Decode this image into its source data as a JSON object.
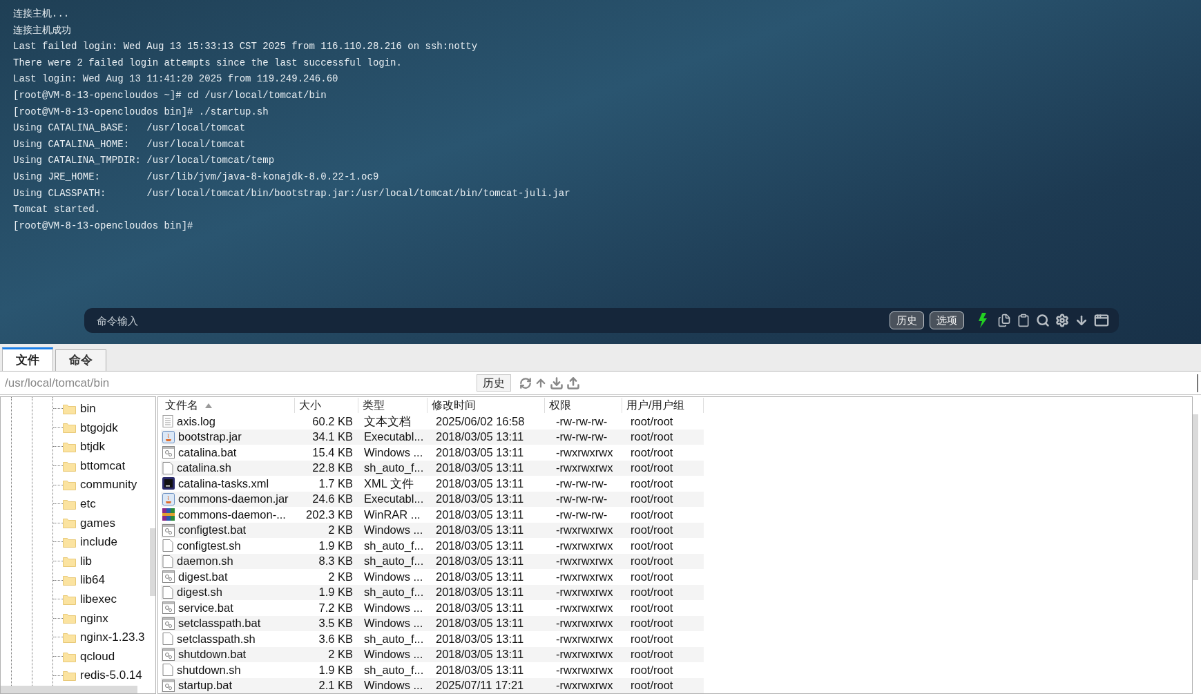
{
  "terminal": {
    "lines": [
      "连接主机...",
      "连接主机成功",
      "Last failed login: Wed Aug 13 15:33:13 CST 2025 from 116.110.28.216 on ssh:notty",
      "There were 2 failed login attempts since the last successful login.",
      "Last login: Wed Aug 13 11:41:20 2025 from 119.249.246.60",
      "[root@VM-8-13-opencloudos ~]# cd /usr/local/tomcat/bin",
      "[root@VM-8-13-opencloudos bin]# ./startup.sh",
      "Using CATALINA_BASE:   /usr/local/tomcat",
      "Using CATALINA_HOME:   /usr/local/tomcat",
      "Using CATALINA_TMPDIR: /usr/local/tomcat/temp",
      "Using JRE_HOME:        /usr/lib/jvm/java-8-konajdk-8.0.22-1.oc9",
      "Using CLASSPATH:       /usr/local/tomcat/bin/bootstrap.jar:/usr/local/tomcat/bin/tomcat-juli.jar",
      "Tomcat started.",
      "[root@VM-8-13-opencloudos bin]#"
    ]
  },
  "command_bar": {
    "placeholder": "命令输入",
    "buttons": [
      "历史",
      "选项"
    ]
  },
  "tabs": [
    {
      "label": "文件",
      "selected": true
    },
    {
      "label": "命令",
      "selected": false
    }
  ],
  "path_bar": {
    "value": "/usr/local/tomcat/bin",
    "history_button": "历史"
  },
  "tree": {
    "items": [
      "bin",
      "btgojdk",
      "btjdk",
      "bttomcat",
      "community",
      "etc",
      "games",
      "include",
      "lib",
      "lib64",
      "libexec",
      "nginx",
      "nginx-1.23.3",
      "qcloud",
      "redis-5.0.14"
    ]
  },
  "table": {
    "columns": [
      {
        "label": "文件名",
        "sorted": true
      },
      {
        "label": "大小",
        "sorted": false
      },
      {
        "label": "类型",
        "sorted": false
      },
      {
        "label": "修改时间",
        "sorted": false
      },
      {
        "label": "权限",
        "sorted": false
      },
      {
        "label": "用户/用户组",
        "sorted": false
      }
    ],
    "rows": [
      {
        "kind": "log",
        "name": "axis.log",
        "size": "60.2 KB",
        "type": "文本文档",
        "modified": "2025/06/02 16:58",
        "permissions": "-rw-rw-rw-",
        "owner": "root/root"
      },
      {
        "kind": "jar",
        "name": "bootstrap.jar",
        "size": "34.1 KB",
        "type": "Executabl...",
        "modified": "2018/03/05 13:11",
        "permissions": "-rw-rw-rw-",
        "owner": "root/root"
      },
      {
        "kind": "bat",
        "name": "catalina.bat",
        "size": "15.4 KB",
        "type": "Windows ...",
        "modified": "2018/03/05 13:11",
        "permissions": "-rwxrwxrwx",
        "owner": "root/root"
      },
      {
        "kind": "sh",
        "name": "catalina.sh",
        "size": "22.8 KB",
        "type": "sh_auto_f...",
        "modified": "2018/03/05 13:11",
        "permissions": "-rwxrwxrwx",
        "owner": "root/root"
      },
      {
        "kind": "xml",
        "name": "catalina-tasks.xml",
        "size": "1.7 KB",
        "type": "XML 文件",
        "modified": "2018/03/05 13:11",
        "permissions": "-rw-rw-rw-",
        "owner": "root/root"
      },
      {
        "kind": "jar",
        "name": "commons-daemon.jar",
        "size": "24.6 KB",
        "type": "Executabl...",
        "modified": "2018/03/05 13:11",
        "permissions": "-rw-rw-rw-",
        "owner": "root/root"
      },
      {
        "kind": "rar",
        "name": "commons-daemon-...",
        "size": "202.3 KB",
        "type": "WinRAR ...",
        "modified": "2018/03/05 13:11",
        "permissions": "-rw-rw-rw-",
        "owner": "root/root"
      },
      {
        "kind": "bat",
        "name": "configtest.bat",
        "size": "2 KB",
        "type": "Windows ...",
        "modified": "2018/03/05 13:11",
        "permissions": "-rwxrwxrwx",
        "owner": "root/root"
      },
      {
        "kind": "sh",
        "name": "configtest.sh",
        "size": "1.9 KB",
        "type": "sh_auto_f...",
        "modified": "2018/03/05 13:11",
        "permissions": "-rwxrwxrwx",
        "owner": "root/root"
      },
      {
        "kind": "sh",
        "name": "daemon.sh",
        "size": "8.3 KB",
        "type": "sh_auto_f...",
        "modified": "2018/03/05 13:11",
        "permissions": "-rwxrwxrwx",
        "owner": "root/root"
      },
      {
        "kind": "bat",
        "name": "digest.bat",
        "size": "2 KB",
        "type": "Windows ...",
        "modified": "2018/03/05 13:11",
        "permissions": "-rwxrwxrwx",
        "owner": "root/root"
      },
      {
        "kind": "sh",
        "name": "digest.sh",
        "size": "1.9 KB",
        "type": "sh_auto_f...",
        "modified": "2018/03/05 13:11",
        "permissions": "-rwxrwxrwx",
        "owner": "root/root"
      },
      {
        "kind": "bat",
        "name": "service.bat",
        "size": "7.2 KB",
        "type": "Windows ...",
        "modified": "2018/03/05 13:11",
        "permissions": "-rwxrwxrwx",
        "owner": "root/root"
      },
      {
        "kind": "bat",
        "name": "setclasspath.bat",
        "size": "3.5 KB",
        "type": "Windows ...",
        "modified": "2018/03/05 13:11",
        "permissions": "-rwxrwxrwx",
        "owner": "root/root"
      },
      {
        "kind": "sh",
        "name": "setclasspath.sh",
        "size": "3.6 KB",
        "type": "sh_auto_f...",
        "modified": "2018/03/05 13:11",
        "permissions": "-rwxrwxrwx",
        "owner": "root/root"
      },
      {
        "kind": "bat",
        "name": "shutdown.bat",
        "size": "2 KB",
        "type": "Windows ...",
        "modified": "2018/03/05 13:11",
        "permissions": "-rwxrwxrwx",
        "owner": "root/root"
      },
      {
        "kind": "sh",
        "name": "shutdown.sh",
        "size": "1.9 KB",
        "type": "sh_auto_f...",
        "modified": "2018/03/05 13:11",
        "permissions": "-rwxrwxrwx",
        "owner": "root/root"
      },
      {
        "kind": "bat",
        "name": "startup.bat",
        "size": "2.1 KB",
        "type": "Windows ...",
        "modified": "2025/07/11 17:21",
        "permissions": "-rwxrwxrwx",
        "owner": "root/root"
      }
    ]
  }
}
